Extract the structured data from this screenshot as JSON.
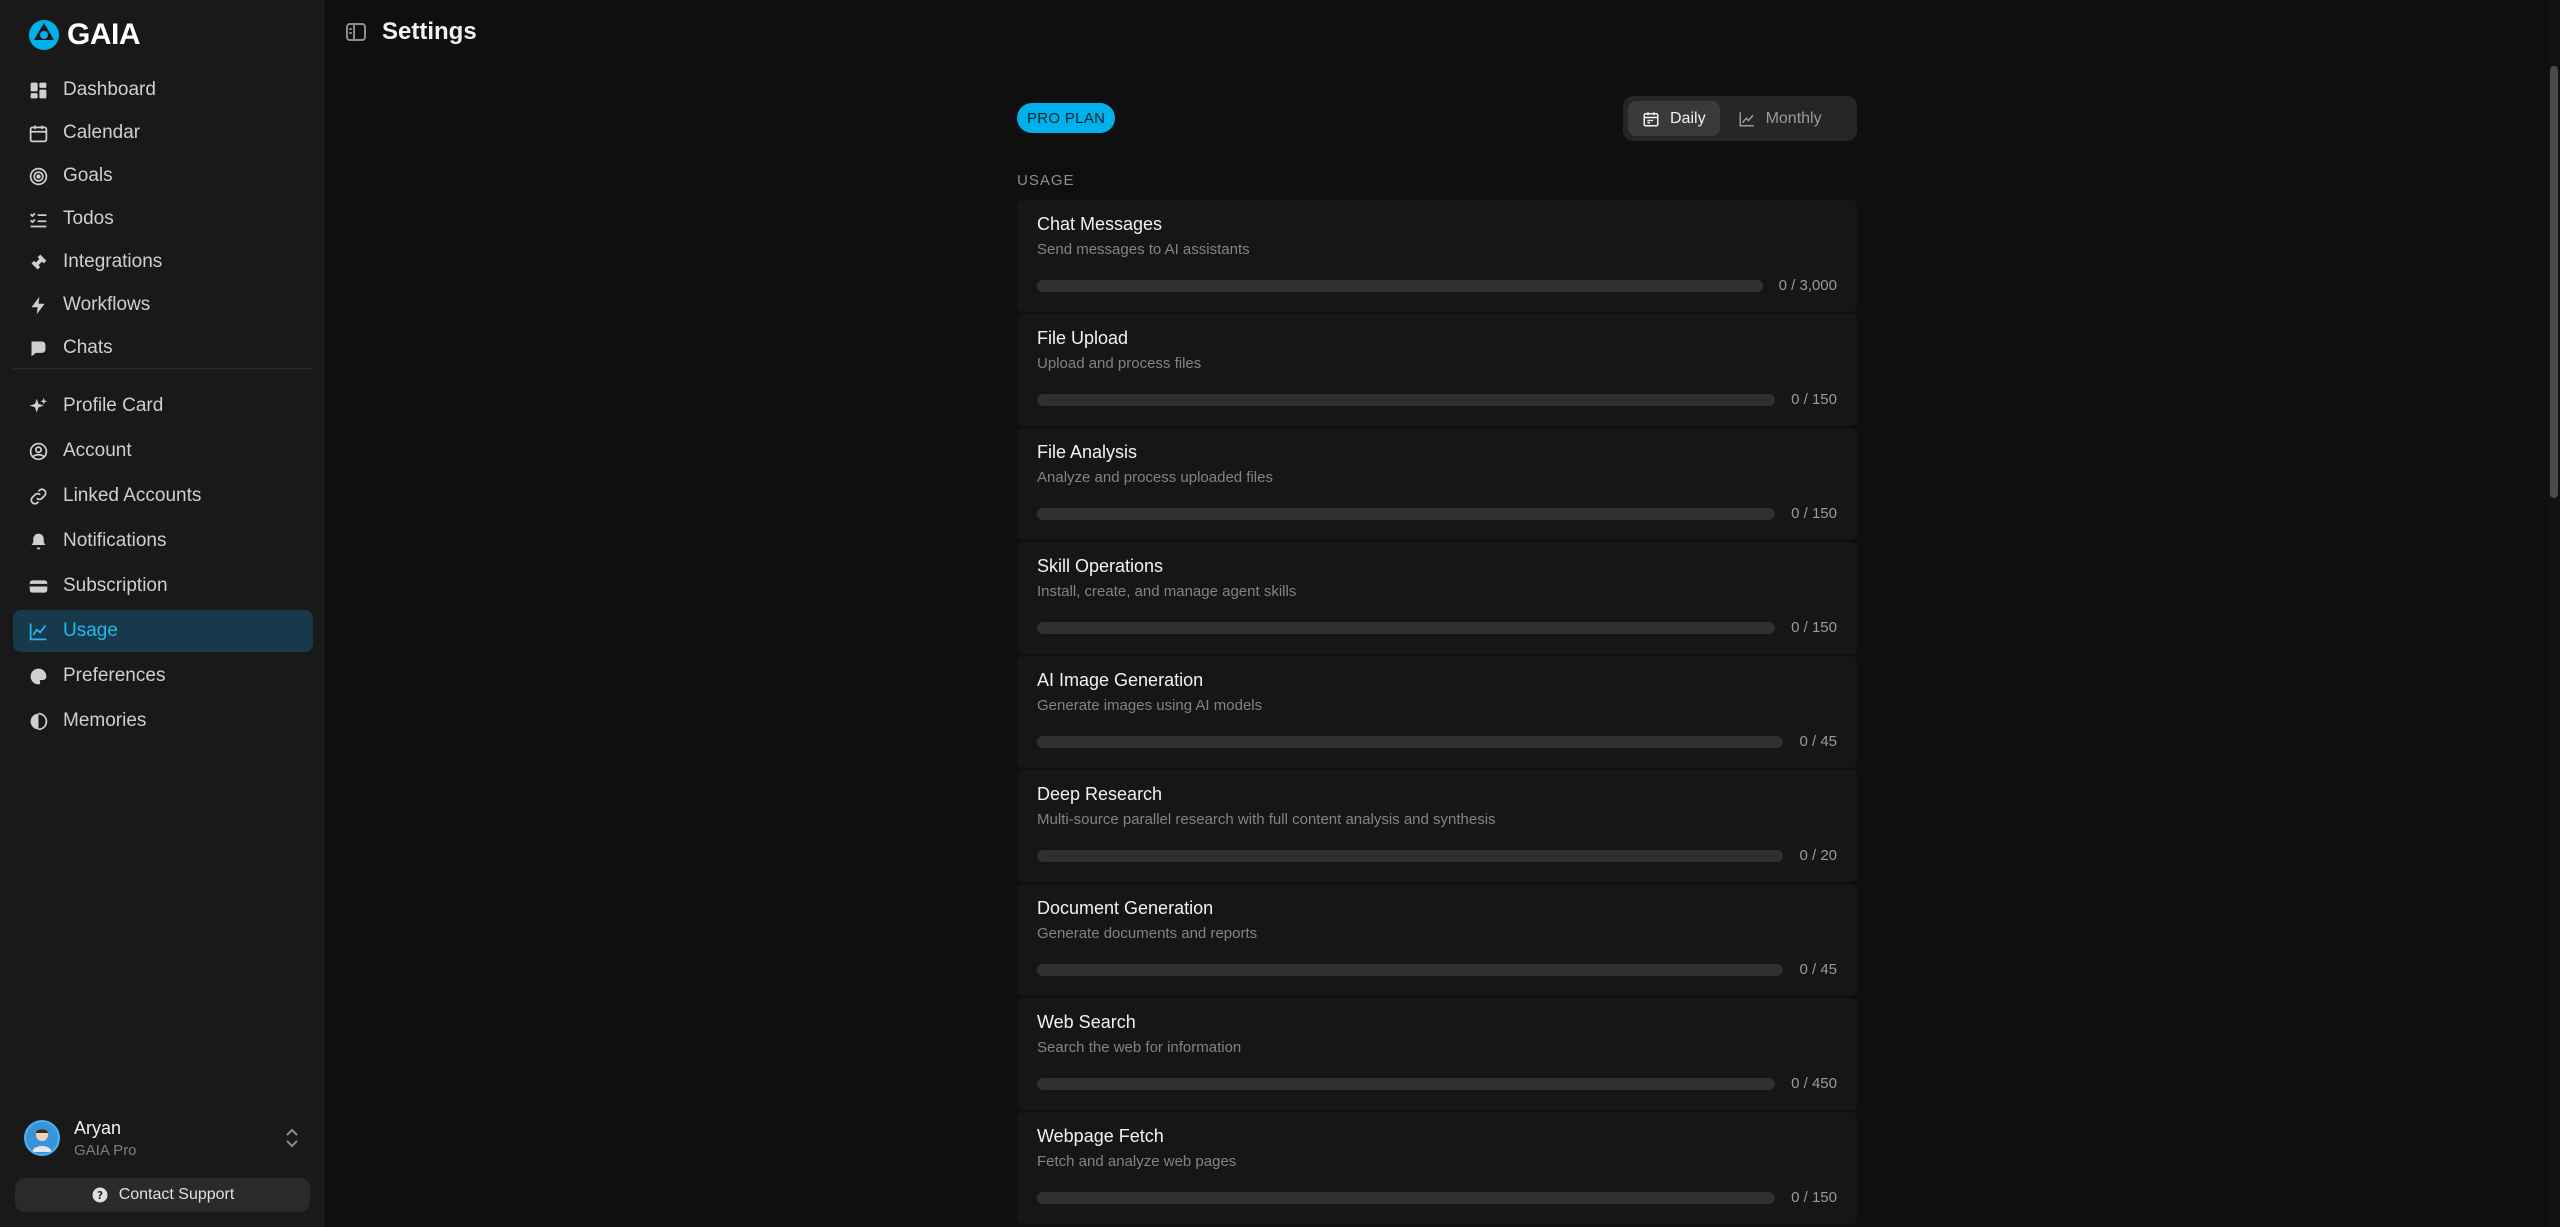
{
  "brand": {
    "name": "GAIA",
    "accent": "#00b0ea"
  },
  "sidebar": {
    "main_items": [
      {
        "label": "Dashboard",
        "icon": "dashboard-icon"
      },
      {
        "label": "Calendar",
        "icon": "calendar-icon"
      },
      {
        "label": "Goals",
        "icon": "target-icon"
      },
      {
        "label": "Todos",
        "icon": "checklist-icon"
      },
      {
        "label": "Integrations",
        "icon": "plug-icon"
      },
      {
        "label": "Workflows",
        "icon": "lightning-icon"
      },
      {
        "label": "Chats",
        "icon": "chat-icon"
      }
    ],
    "settings_items": [
      {
        "label": "Profile Card",
        "icon": "sparkle-icon"
      },
      {
        "label": "Account",
        "icon": "user-circle-icon"
      },
      {
        "label": "Linked Accounts",
        "icon": "link-icon"
      },
      {
        "label": "Notifications",
        "icon": "bell-icon"
      },
      {
        "label": "Subscription",
        "icon": "credit-card-icon"
      },
      {
        "label": "Usage",
        "icon": "chart-line-icon",
        "active": true
      },
      {
        "label": "Preferences",
        "icon": "palette-icon"
      },
      {
        "label": "Memories",
        "icon": "brain-icon"
      }
    ],
    "user": {
      "name": "Aryan",
      "plan": "GAIA Pro"
    },
    "support_label": "Contact Support"
  },
  "header": {
    "title": "Settings"
  },
  "content": {
    "plan_badge": "PRO PLAN",
    "toggle": {
      "daily": "Daily",
      "monthly": "Monthly",
      "selected": "Daily"
    },
    "section_label": "USAGE",
    "usage": [
      {
        "name": "Chat Messages",
        "description": "Send messages to AI assistants",
        "used": 0,
        "limit": "3,000",
        "count": "0 / 3,000",
        "fraction": 0
      },
      {
        "name": "File Upload",
        "description": "Upload and process files",
        "used": 0,
        "limit": "150",
        "count": "0 / 150",
        "fraction": 0
      },
      {
        "name": "File Analysis",
        "description": "Analyze and process uploaded files",
        "used": 0,
        "limit": "150",
        "count": "0 / 150",
        "fraction": 0
      },
      {
        "name": "Skill Operations",
        "description": "Install, create, and manage agent skills",
        "used": 0,
        "limit": "150",
        "count": "0 / 150",
        "fraction": 0
      },
      {
        "name": "AI Image Generation",
        "description": "Generate images using AI models",
        "used": 0,
        "limit": "45",
        "count": "0 / 45",
        "fraction": 0
      },
      {
        "name": "Deep Research",
        "description": "Multi-source parallel research with full content analysis and synthesis",
        "used": 0,
        "limit": "20",
        "count": "0 / 20",
        "fraction": 0
      },
      {
        "name": "Document Generation",
        "description": "Generate documents and reports",
        "used": 0,
        "limit": "45",
        "count": "0 / 45",
        "fraction": 0
      },
      {
        "name": "Web Search",
        "description": "Search the web for information",
        "used": 0,
        "limit": "450",
        "count": "0 / 450",
        "fraction": 0
      },
      {
        "name": "Webpage Fetch",
        "description": "Fetch and analyze web pages",
        "used": 0,
        "limit": "150",
        "count": "0 / 150",
        "fraction": 0
      }
    ]
  }
}
